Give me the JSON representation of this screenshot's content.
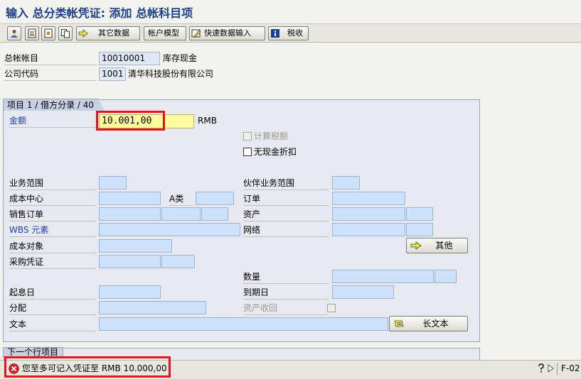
{
  "title": "输入 总分类帐凭证: 添加 总帐科目项",
  "toolbar": {
    "buttons": [
      {
        "label": ""
      },
      {
        "label": ""
      },
      {
        "label": ""
      },
      {
        "label": ""
      },
      {
        "label": "其它数据"
      },
      {
        "label": "帐户模型"
      },
      {
        "label": "快速数据输入"
      },
      {
        "label": "税收"
      }
    ]
  },
  "header": {
    "gl_account_label": "总帐帐目",
    "gl_account_value": "10010001",
    "gl_account_desc": "库存现金",
    "company_code_label": "公司代码",
    "company_code_value": "1001",
    "company_code_desc": "清华科技股份有限公司"
  },
  "item_group": {
    "title": "项目 1 / 借方分录 / 40",
    "amount_label": "金额",
    "amount_value": "10.001,00",
    "currency": "RMB",
    "calc_tax_label": "计算税额",
    "no_cash_discount_label": "无现金折扣",
    "business_area_label": "业务范围",
    "trading_partner_ba_label": "伙伴业务范围",
    "cost_center_label": "成本中心",
    "a_type_label": "A类",
    "order_label": "订单",
    "sales_order_label": "销售订单",
    "asset_label": "资产",
    "wbs_label": "WBS 元素",
    "network_label": "网络",
    "cost_object_label": "成本对象",
    "other_button_label": "其他",
    "purchasing_doc_label": "采购凭证",
    "quantity_label": "数量",
    "value_date_label": "起息日",
    "due_on_label": "到期日",
    "assignment_label": "分配",
    "asset_retirement_label": "资产收回",
    "text_label": "文本",
    "long_text_button_label": "长文本"
  },
  "next_item_group": {
    "title": "下一个行项目"
  },
  "status_bar": {
    "message": "您至多可记入凭证至 RMB 10.000,00",
    "system_info": "F-02"
  },
  "colors": {
    "title": "#1f3f86",
    "highlight_border": "#e8121d",
    "error_icon": "#d8232a"
  }
}
